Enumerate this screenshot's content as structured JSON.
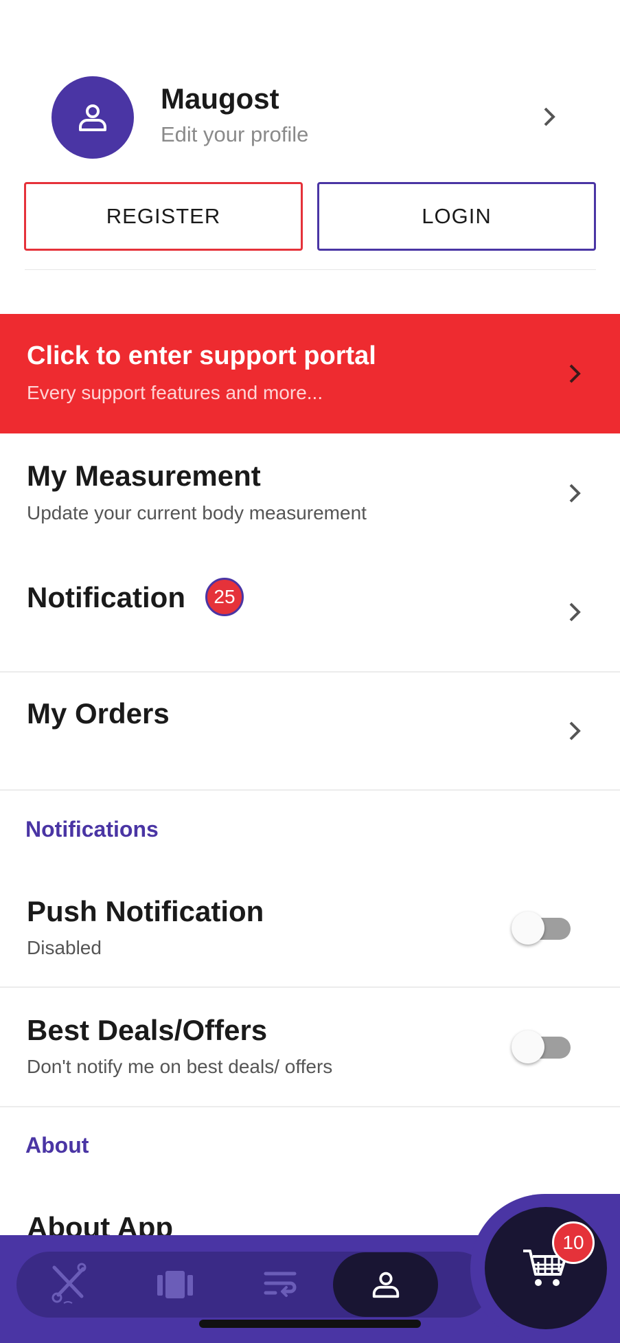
{
  "profile": {
    "name": "Maugost",
    "subtitle": "Edit your profile"
  },
  "auth": {
    "register_label": "REGISTER",
    "login_label": "LOGIN"
  },
  "support": {
    "title": "Click to enter support portal",
    "subtitle": "Every support features and more..."
  },
  "menu": {
    "measurement": {
      "title": "My Measurement",
      "subtitle": "Update your current body measurement"
    },
    "notification": {
      "title": "Notification",
      "badge": "25"
    },
    "orders": {
      "title": "My Orders"
    }
  },
  "notifications_section": {
    "heading": "Notifications",
    "push": {
      "title": "Push Notification",
      "subtitle": "Disabled",
      "enabled": false
    },
    "deals": {
      "title": "Best Deals/Offers",
      "subtitle": "Don't notify me on best deals/ offers",
      "enabled": false
    }
  },
  "about_section": {
    "heading": "About",
    "about_app": "About App"
  },
  "bottom_nav": {
    "items": [
      {
        "icon": "tailor-tools-icon",
        "active": false
      },
      {
        "icon": "fabric-icon",
        "active": false
      },
      {
        "icon": "orders-list-icon",
        "active": false
      },
      {
        "icon": "user-icon",
        "active": true
      }
    ],
    "cart_count": "10"
  },
  "colors": {
    "accent": "#4a35a4",
    "danger": "#ee2b30",
    "dark": "#191533"
  }
}
